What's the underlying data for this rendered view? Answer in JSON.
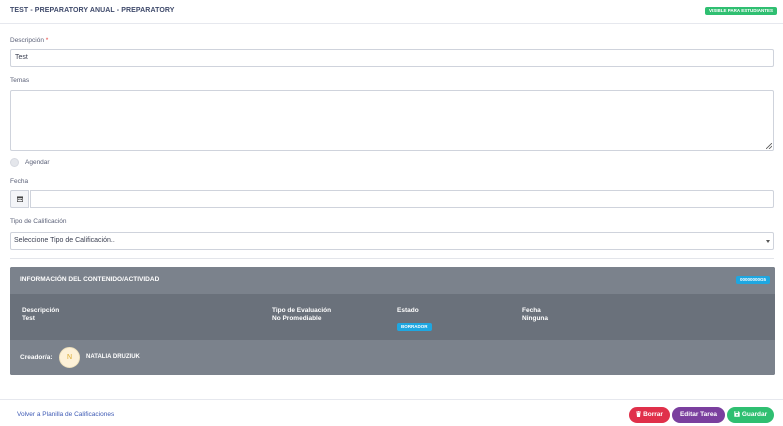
{
  "header": {
    "title": "TEST - PREPARATORY ANUAL - PREPARATORY",
    "visibility_badge": "VISIBLE PARA ESTUDIANTES"
  },
  "form": {
    "descripcion_label": "Descripción",
    "required_mark": "*",
    "descripcion_value": "Test",
    "temas_label": "Temas",
    "temas_value": "",
    "agendar_label": "Agendar",
    "fecha_label": "Fecha",
    "fecha_value": "",
    "tipo_label": "Tipo de Calificación",
    "tipo_selected": "Seleccione Tipo de Calificación.."
  },
  "info_card": {
    "title": "INFORMACIÓN DEL CONTENIDO/ACTIVIDAD",
    "badge": "00000000G5",
    "columns": [
      {
        "header": "Descripción",
        "value": "Test"
      },
      {
        "header": "Tipo de Evaluación",
        "value": "No Promediable"
      },
      {
        "header": "Estado",
        "value": "BORRADOR"
      },
      {
        "header": "Fecha",
        "value": "Ninguna"
      }
    ],
    "creator_label": "Creador/a:",
    "creator_initial": "N",
    "creator_name": "NATALIA DRUZIUK"
  },
  "footer": {
    "back_link": "Volver a Planilla de Calificaciones",
    "delete_label": "Borrar",
    "edit_label": "Editar Tarea",
    "save_label": "Guardar"
  },
  "colors": {
    "accent_green": "#2fbf71",
    "accent_blue": "#1ea7e1",
    "delete_red": "#e0304a",
    "edit_purple": "#7a3f9e",
    "card_gray": "#6c737d"
  }
}
